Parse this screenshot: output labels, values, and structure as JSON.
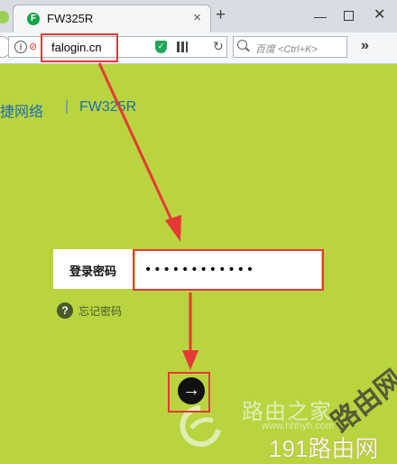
{
  "browser": {
    "tab_title": "FW325R",
    "tab_favicon": "F",
    "close_tab": "×",
    "new_tab": "+",
    "window_min": "—",
    "window_close": "✕",
    "url": "falogin.cn",
    "search_placeholder": "百度 <Ctrl+K>",
    "more": "»",
    "refresh": "↻"
  },
  "page": {
    "brand": "捷网络",
    "separator": "|",
    "model": "FW325R",
    "password_label": "登录密码",
    "password_value": "••••••••••••",
    "forgot_icon": "?",
    "forgot_label": "忘记密码",
    "submit": "→"
  },
  "watermark": {
    "name": "路由之家",
    "url": "www.hhhyh.com",
    "site": "191路由网",
    "stamp": "路由网"
  },
  "colors": {
    "page_bg": "#b9d43f",
    "highlight": "#e53935",
    "header_text": "#1e6fa8"
  },
  "icons": [
    "info-icon",
    "lock-icon",
    "shield-icon",
    "qr-code-icon",
    "search-icon",
    "question-icon",
    "arrow-right-icon"
  ]
}
